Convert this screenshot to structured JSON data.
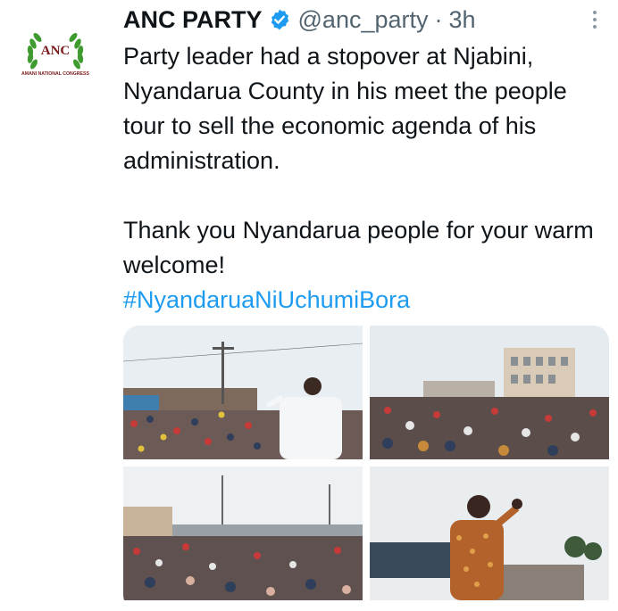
{
  "tweet": {
    "avatar": {
      "logo_text": "ANC",
      "org_text": "AMANI NATIONAL CONGRESS",
      "colors": {
        "wreath": "#3f9b2f",
        "text": "#7a1a1a"
      }
    },
    "author_name": "ANC PARTY",
    "verified": true,
    "handle": "@anc_party",
    "separator": "·",
    "time": "3h",
    "text_line_1": "Party leader had a stopover at Njabini, Nyandarua County in his meet the people tour to sell the economic agenda of his administration.",
    "text_line_2": "Thank you Nyandarua people for your warm welcome!",
    "hashtag": "#NyandaruaNiUchumiBora",
    "colors": {
      "link": "#1d9bf0",
      "verified_badge": "#1d9bf0",
      "muted": "#536471"
    },
    "media": [
      {
        "description_icon": "rally-photo-1"
      },
      {
        "description_icon": "rally-photo-2"
      },
      {
        "description_icon": "rally-photo-3"
      },
      {
        "description_icon": "rally-photo-4"
      }
    ]
  }
}
